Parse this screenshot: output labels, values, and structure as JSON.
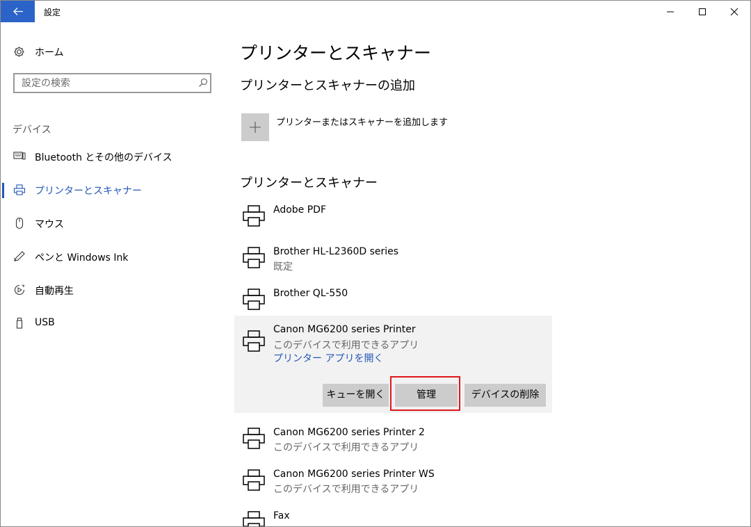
{
  "window": {
    "title": "設定"
  },
  "sidebar": {
    "home_label": "ホーム",
    "search_placeholder": "設定の検索",
    "section_label": "デバイス",
    "items": [
      {
        "label": "Bluetooth とその他のデバイス",
        "icon": "bluetooth-devices-icon"
      },
      {
        "label": "プリンターとスキャナー",
        "icon": "printer-icon",
        "selected": true
      },
      {
        "label": "マウス",
        "icon": "mouse-icon"
      },
      {
        "label": "ペンと Windows Ink",
        "icon": "pen-icon"
      },
      {
        "label": "自動再生",
        "icon": "autoplay-icon"
      },
      {
        "label": "USB",
        "icon": "usb-icon"
      }
    ]
  },
  "main": {
    "title": "プリンターとスキャナー",
    "add_heading": "プリンターとスキャナーの追加",
    "add_label": "プリンターまたはスキャナーを追加します",
    "list_heading": "プリンターとスキャナー",
    "printers": [
      {
        "name": "Adobe PDF",
        "sub": ""
      },
      {
        "name": "Brother HL-L2360D series",
        "sub": "既定"
      },
      {
        "name": "Brother QL-550",
        "sub": ""
      },
      {
        "name": "Canon MG6200 series Printer",
        "sub": "このデバイスで利用できるアプリ",
        "link": "プリンター アプリを開く",
        "expanded": true
      },
      {
        "name": "Canon MG6200 series Printer 2",
        "sub": "このデバイスで利用できるアプリ"
      },
      {
        "name": "Canon MG6200 series Printer WS",
        "sub": "このデバイスで利用できるアプリ"
      },
      {
        "name": "Fax",
        "sub": ""
      }
    ],
    "actions": {
      "open_queue": "キューを開く",
      "manage": "管理",
      "remove_device": "デバイスの削除"
    }
  },
  "colors": {
    "accent": "#2456b8",
    "titlebar_back": "#2b63c8",
    "highlight": "#e0161a",
    "expanded_bg": "#f2f2f2",
    "button_bg": "#cccccc"
  }
}
